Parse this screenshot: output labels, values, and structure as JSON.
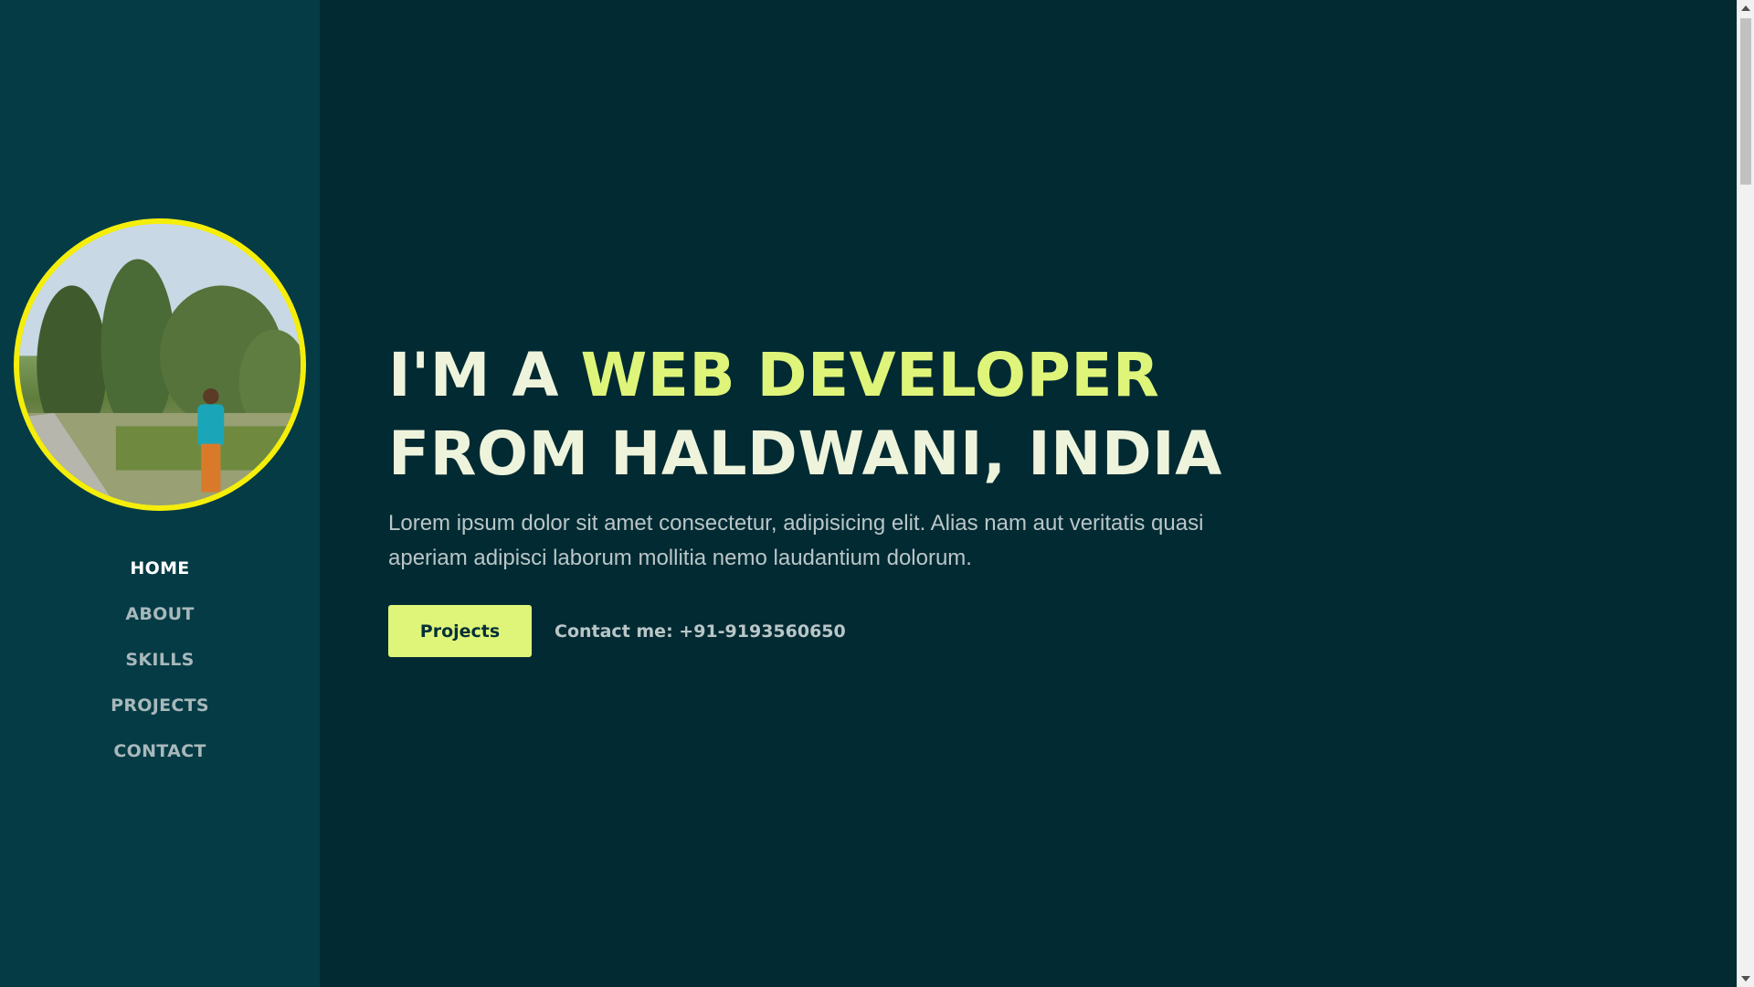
{
  "sidebar": {
    "avatar_alt": "profile photo",
    "nav": [
      {
        "label": "HOME",
        "active": true
      },
      {
        "label": "ABOUT",
        "active": false
      },
      {
        "label": "SKILLS",
        "active": false
      },
      {
        "label": "PROJECTS",
        "active": false
      },
      {
        "label": "CONTACT",
        "active": false
      }
    ]
  },
  "hero": {
    "headline_prefix": "I'M A ",
    "headline_accent": "WEB DEVELOPER",
    "headline_line2": "FROM HALDWANI, INDIA",
    "description": "Lorem ipsum dolor sit amet consectetur, adipisicing elit. Alias nam aut veritatis quasi aperiam adipisci laborum mollitia nemo laudantium dolorum.",
    "projects_button": "Projects",
    "contact_text": "Contact me: +91-9193560650"
  },
  "colors": {
    "sidebar_bg": "#043b45",
    "main_bg": "#022a32",
    "accent": "#dff57a",
    "avatar_border": "#f4ee0a"
  },
  "icons": {
    "scroll_up": "chevron-up-icon",
    "scroll_down": "chevron-down-icon"
  }
}
